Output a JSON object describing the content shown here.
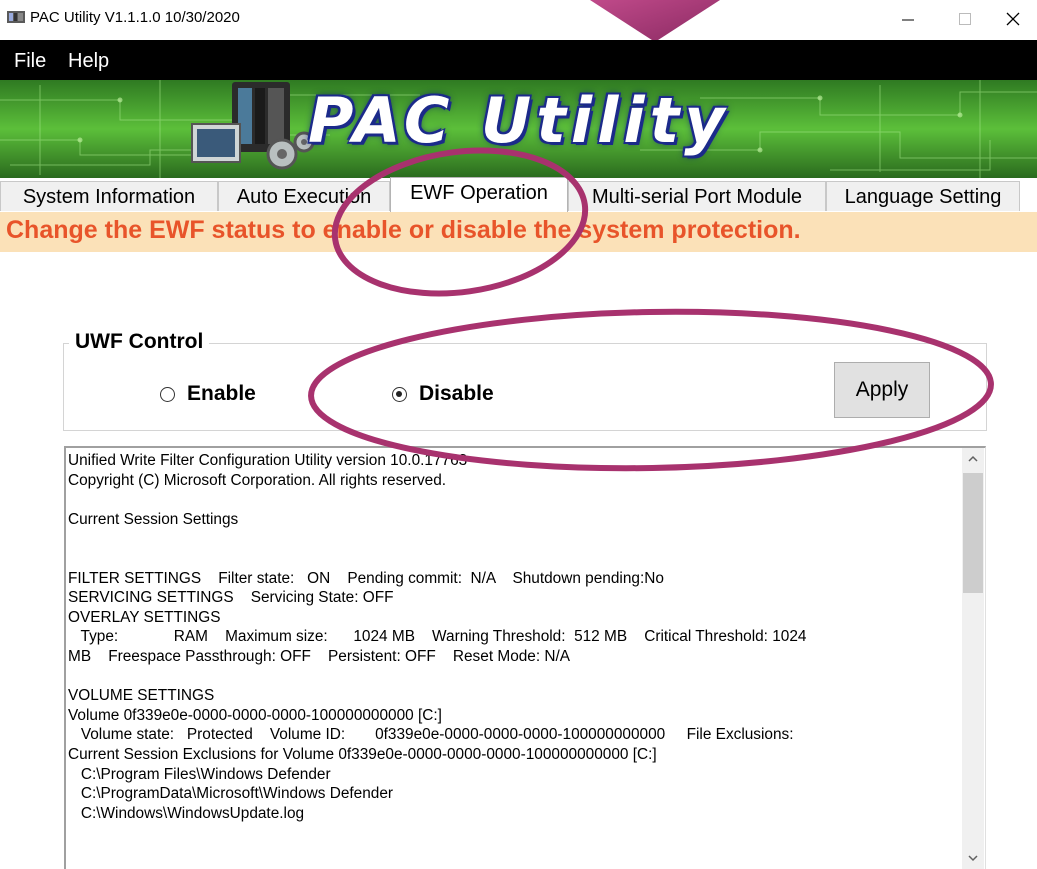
{
  "window": {
    "title": "PAC Utility V1.1.1.0  10/30/2020",
    "app_icon": "pac-app-icon",
    "controls": [
      "minimize-icon",
      "maximize-icon",
      "close-icon"
    ]
  },
  "menu": {
    "items": [
      {
        "label": "File"
      },
      {
        "label": "Help"
      }
    ]
  },
  "banner": {
    "title": "PAC Utility",
    "logo_icon": "pac-hardware-gear-icon"
  },
  "tabs": [
    {
      "label": "System Information",
      "active": false
    },
    {
      "label": "Auto Execution",
      "active": false
    },
    {
      "label": "EWF Operation",
      "active": true
    },
    {
      "label": "Multi-serial Port Module",
      "active": false
    },
    {
      "label": "Language Setting",
      "active": false
    }
  ],
  "notice": {
    "text": "Change the EWF status to enable or disable the system protection."
  },
  "uwf_control": {
    "legend": "UWF Control",
    "options": [
      {
        "label": "Enable",
        "checked": false
      },
      {
        "label": "Disable",
        "checked": true
      }
    ],
    "apply_label": "Apply"
  },
  "output": {
    "lines": [
      "Unified Write Filter Configuration Utility version 10.0.17763",
      "Copyright (C) Microsoft Corporation. All rights reserved.",
      "",
      "Current Session Settings",
      "",
      "",
      "FILTER SETTINGS    Filter state:   ON    Pending commit:  N/A    Shutdown pending:No",
      "SERVICING SETTINGS    Servicing State: OFF",
      "OVERLAY SETTINGS",
      "   Type:             RAM    Maximum size:      1024 MB    Warning Threshold:  512 MB    Critical Threshold: 1024",
      "MB    Freespace Passthrough: OFF    Persistent: OFF    Reset Mode: N/A",
      "",
      "VOLUME SETTINGS",
      "Volume 0f339e0e-0000-0000-0000-100000000000 [C:]",
      "   Volume state:   Protected    Volume ID:       0f339e0e-0000-0000-0000-100000000000     File Exclusions:",
      "Current Session Exclusions for Volume 0f339e0e-0000-0000-0000-100000000000 [C:]",
      "   C:\\Program Files\\Windows Defender",
      "   C:\\ProgramData\\Microsoft\\Windows Defender",
      "   C:\\Windows\\WindowsUpdate.log"
    ],
    "scroll_icons": [
      "scroll-up-icon",
      "scroll-down-icon"
    ]
  },
  "colors": {
    "menubar": "#000000",
    "notice_bg": "#fbe1b8",
    "notice_text": "#e8542a",
    "highlight": "#a8326e",
    "banner_green": "#3fae2a"
  }
}
